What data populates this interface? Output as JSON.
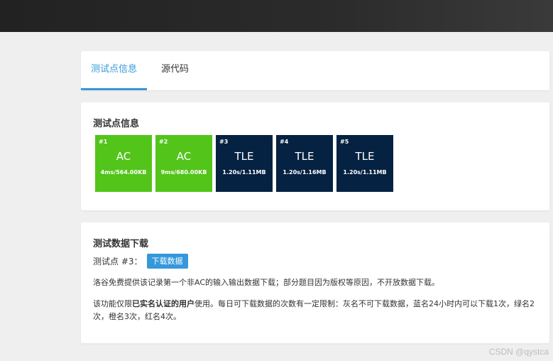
{
  "tabs": [
    {
      "label": "测试点信息"
    },
    {
      "label": "源代码"
    }
  ],
  "cases_section": {
    "title": "测试点信息",
    "cases": [
      {
        "id": "#1",
        "status": "AC",
        "meta": "4ms/564.00KB",
        "color": "#52c41a"
      },
      {
        "id": "#2",
        "status": "AC",
        "meta": "9ms/680.00KB",
        "color": "#52c41a"
      },
      {
        "id": "#3",
        "status": "TLE",
        "meta": "1.20s/1.11MB",
        "color": "#052242"
      },
      {
        "id": "#4",
        "status": "TLE",
        "meta": "1.20s/1.16MB",
        "color": "#052242"
      },
      {
        "id": "#5",
        "status": "TLE",
        "meta": "1.20s/1.11MB",
        "color": "#052242"
      }
    ]
  },
  "download_section": {
    "title": "测试数据下载",
    "case_label": "测试点 #3：",
    "button_label": "下载数据",
    "para1": "洛谷免费提供该记录第一个非AC的输入输出数据下载；部分题目因为版权等原因，不开放数据下载。",
    "para2_prefix": "该功能仅限",
    "para2_bold": "已实名认证的用户",
    "para2_suffix": "使用。每日可下载数据的次数有一定限制：灰名不可下载数据，蓝名24小时内可以下载1次，绿名2次，橙名3次，红名4次。"
  },
  "watermark": "CSDN @qystca",
  "colors": {
    "accent": "#3498db",
    "ac": "#52c41a",
    "tle": "#052242"
  }
}
